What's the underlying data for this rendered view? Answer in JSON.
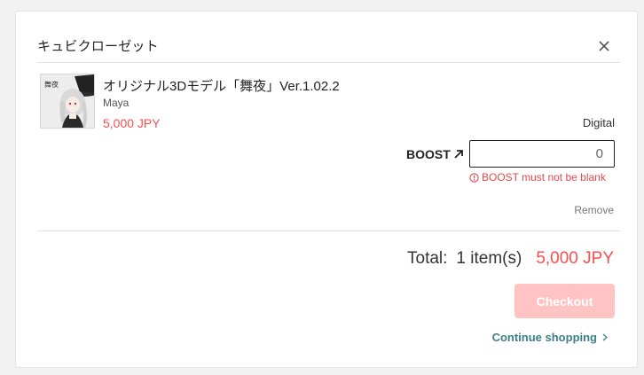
{
  "header": {
    "title": "キュビクローゼット"
  },
  "item": {
    "title": "オリジナル3Dモデル「舞夜」Ver.1.02.2",
    "author": "Maya",
    "price": "5,000 JPY",
    "type": "Digital",
    "thumbnail_icon": "avatar-character-thumbnail",
    "thumbnail_text": "舞夜"
  },
  "boost": {
    "label": "BOOST",
    "icon": "arrow-up-right-icon",
    "value": "0",
    "error": "BOOST must not be blank",
    "error_icon": "alert-circle-icon"
  },
  "remove_label": "Remove",
  "summary": {
    "total_label": "Total:",
    "count": "1 item(s)",
    "total_price": "5,000 JPY"
  },
  "checkout_label": "Checkout",
  "continue_label": "Continue shopping",
  "colors": {
    "accent": "#fc4d50",
    "checkout_disabled": "#ffc3c4",
    "link": "#3e7f88",
    "error": "#e34a4a"
  }
}
